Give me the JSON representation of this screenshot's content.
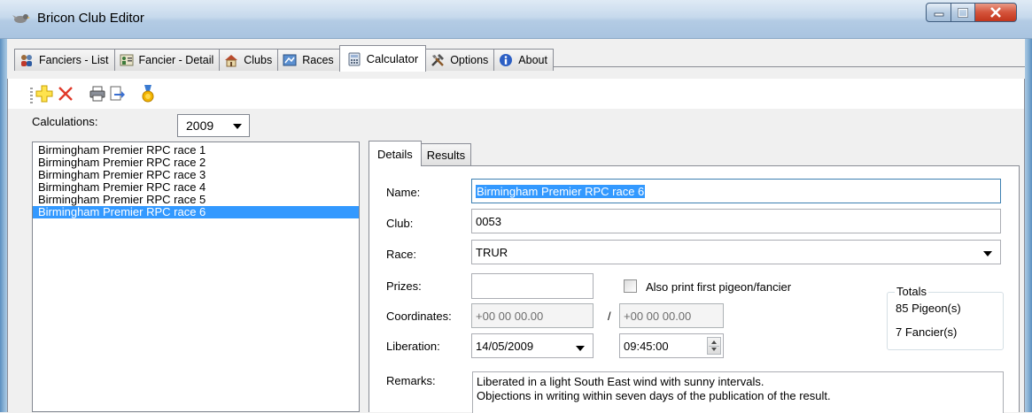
{
  "window": {
    "title": "Bricon Club Editor"
  },
  "tabs": [
    {
      "label": "Fanciers - List",
      "icon": "fanciers-icon"
    },
    {
      "label": "Fancier - Detail",
      "icon": "fancier-detail-icon"
    },
    {
      "label": "Clubs",
      "icon": "clubs-icon"
    },
    {
      "label": "Races",
      "icon": "races-icon"
    },
    {
      "label": "Calculator",
      "icon": "calculator-icon",
      "active": true
    },
    {
      "label": "Options",
      "icon": "tools-icon"
    },
    {
      "label": "About",
      "icon": "info-icon"
    }
  ],
  "toolbar": {
    "buttons": [
      "add-icon",
      "delete-icon",
      "print-icon",
      "export-icon",
      "medal-icon"
    ]
  },
  "calculations": {
    "label": "Calculations:",
    "year": "2009",
    "items": [
      "Birmingham Premier RPC race 1",
      "Birmingham Premier RPC race 2",
      "Birmingham Premier RPC race 3",
      "Birmingham Premier RPC race 4",
      "Birmingham Premier RPC race 5",
      "Birmingham Premier RPC race 6"
    ],
    "selected_index": 5
  },
  "detail_tabs": [
    "Details",
    "Results"
  ],
  "details": {
    "name_label": "Name:",
    "name_value": "Birmingham Premier RPC race 6",
    "club_label": "Club:",
    "club_value": "0053",
    "race_label": "Race:",
    "race_value": "TRUR",
    "prizes_label": "Prizes:",
    "prizes_value": "",
    "also_print_label": "Also print first pigeon/fancier",
    "also_print_checked": false,
    "coordinates_label": "Coordinates:",
    "coord_1": "+00 00 00.00",
    "coord_sep": "/",
    "coord_2": "+00 00 00.00",
    "liberation_label": "Liberation:",
    "liberation_date": "14/05/2009",
    "liberation_time": "09:45:00",
    "remarks_label": "Remarks:",
    "remarks_line1": "Liberated in a light South East wind with sunny intervals.",
    "remarks_line2": "Objections in writing within seven days of the publication of the result."
  },
  "totals": {
    "label": "Totals",
    "pigeons": "85 Pigeon(s)",
    "fanciers": "7 Fancier(s)"
  },
  "colors": {
    "selection": "#3399ff",
    "close_button": "#c2351c",
    "titlebar": "#c6d9ec"
  }
}
